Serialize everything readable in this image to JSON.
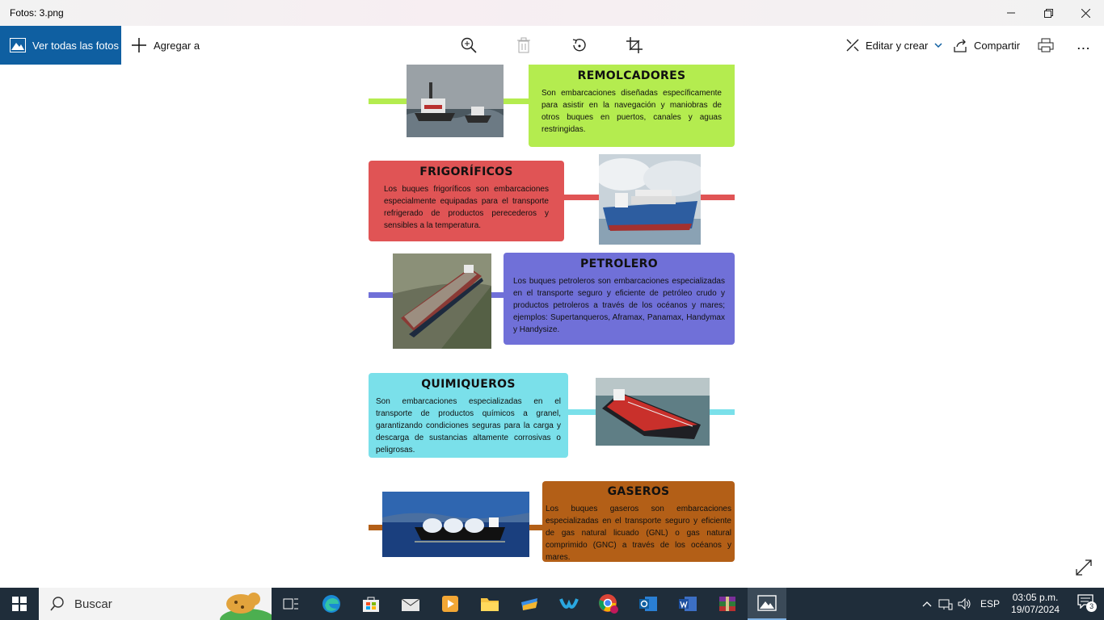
{
  "window": {
    "title": "Fotos: 3.png"
  },
  "toolbar": {
    "all_photos_label": "Ver todas las fotos",
    "add_to_label": "Agregar a",
    "edit_create_label": "Editar y crear",
    "share_label": "Compartir",
    "more_label": "..."
  },
  "infographic": {
    "sections": [
      {
        "id": "remolcadores",
        "title": "REMOLCADORES",
        "text": "Son embarcaciones diseñadas específicamente para asistir en la navegación y maniobras de otros buques en puertos, canales y aguas restringidas.",
        "color": "#b4ec4f"
      },
      {
        "id": "frigorificos",
        "title": "FRIGORÍFICOS",
        "text": "Los buques frigoríficos son embarcaciones especialmente equipadas para el transporte refrigerado de productos perecederos y sensibles a la temperatura.",
        "color": "#e05455"
      },
      {
        "id": "petrolero",
        "title": "PETROLERO",
        "text": "Los buques petroleros son embarcaciones especializadas en el transporte seguro y eficiente de petróleo crudo y productos petroleros a través de los océanos y mares; ejemplos: Supertanqueros, Aframax, Panamax, Handymax y Handysize.",
        "color": "#7070d8"
      },
      {
        "id": "quimiqueros",
        "title": "QUIMIQUEROS",
        "text": "Son embarcaciones especializadas en el transporte de productos químicos a granel, garantizando condiciones seguras para la carga y descarga de sustancias altamente corrosivas o peligrosas.",
        "color": "#7ae0ea"
      },
      {
        "id": "gaseros",
        "title": "GASEROS",
        "text": "Los buques gaseros son embarcaciones especializadas en el transporte seguro y eficiente de gas natural licuado (GNL) o gas natural comprimido (GNC) a través de los océanos y mares.",
        "color": "#b35f17"
      }
    ]
  },
  "taskbar": {
    "search_placeholder": "Buscar",
    "language": "ESP",
    "time": "03:05 p.m.",
    "date": "19/07/2024",
    "notifications": "3"
  }
}
